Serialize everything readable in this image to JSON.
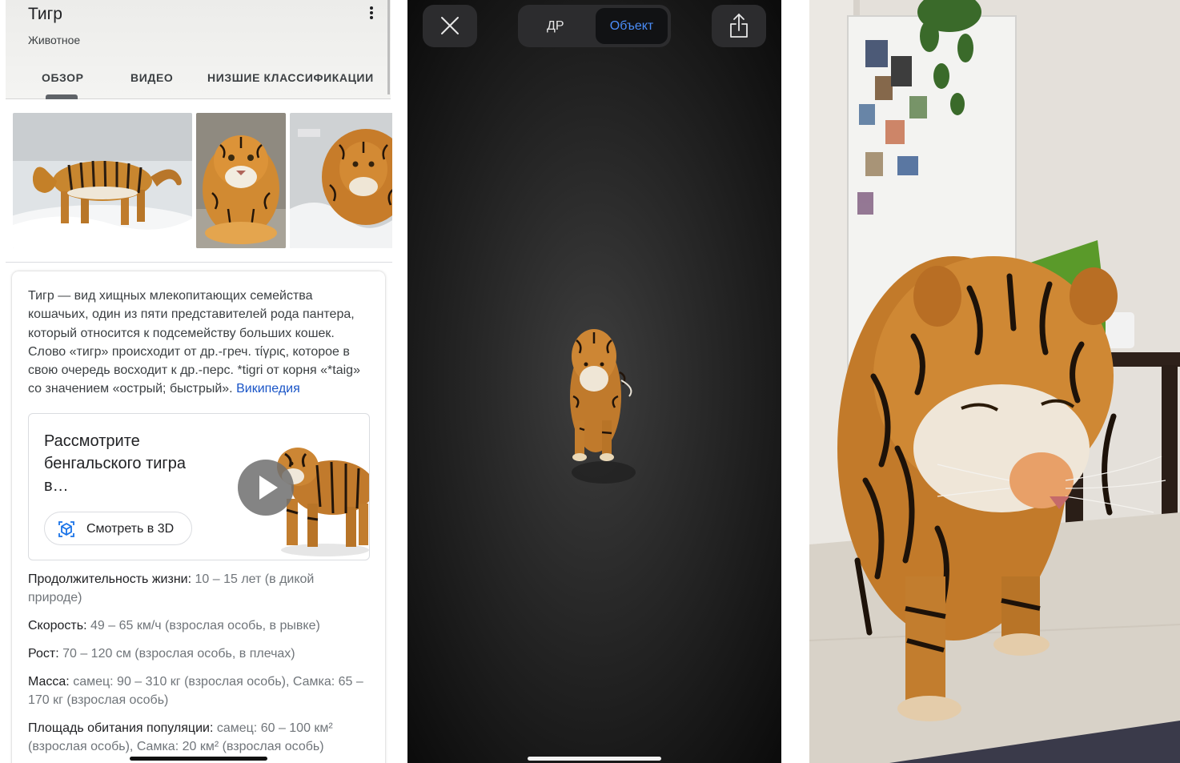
{
  "knowledge_panel": {
    "title": "Тигр",
    "subtitle": "Животное",
    "tabs": [
      {
        "label": "ОБЗОР",
        "active": true
      },
      {
        "label": "ВИДЕО",
        "active": false
      },
      {
        "label": "НИЗШИЕ КЛАССИФИКАЦИИ",
        "active": false
      }
    ],
    "description": "Тигр — вид хищных млекопитающих семейства кошачьих, один из пяти представителей рода пантера, который относится к подсемейству больших кошек. Слово «тигр» происходит от др.-греч. τίγρις, которое в свою очередь восходит к др.-перс. *tigri от корня «*taig» со значением «острый; быстрый».",
    "source_link": "Википедия",
    "view3d": {
      "title": "Рассмотрите бенгальского тигра в…",
      "button_label": "Смотреть в 3D"
    },
    "facts": [
      {
        "label": "Продолжительность жизни:",
        "value": "10 – 15 лет (в дикой природе)"
      },
      {
        "label": "Скорость:",
        "value": "49 – 65 км/ч (взрослая особь, в рывке)"
      },
      {
        "label": "Рост:",
        "value": "70 – 120 см (взрослая особь, в плечах)"
      },
      {
        "label": "Масса:",
        "value": "самец: 90 – 310 кг (взрослая особь), Самка: 65 – 170 кг (взрослая особь)"
      },
      {
        "label": "Площадь обитания популяции:",
        "value": "самец: 60 – 100 км² (взрослая особь), Самка: 20 км² (взрослая особь)"
      }
    ],
    "colors": {
      "link": "#1a55c7",
      "fact_value": "#70757a"
    }
  },
  "ar_viewer": {
    "segment": [
      {
        "label": "ДР",
        "active": false
      },
      {
        "label": "Объект",
        "active": true
      }
    ],
    "icons": {
      "close": "close-icon",
      "share": "share-icon"
    },
    "colors": {
      "active_segment": "#4b8df8",
      "background": "#1d1d1d"
    }
  }
}
